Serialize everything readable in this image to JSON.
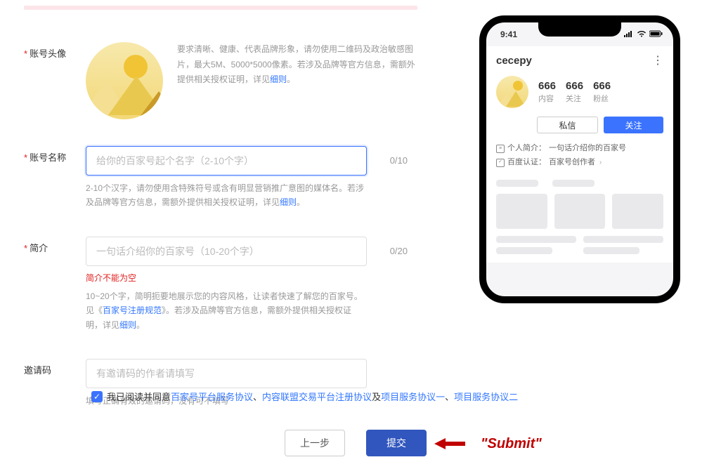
{
  "form": {
    "avatar": {
      "label": "账号头像",
      "desc_p1": "要求清晰、健康、代表品牌形象，请勿使用二维码及政治敏感图片，最大5M、5000*5000像素。若涉及品牌等官方信息，需额外提供相关授权证明，详见",
      "desc_link": "细则",
      "desc_end": "。"
    },
    "name": {
      "label": "账号名称",
      "placeholder": "给你的百家号起个名字（2-10个字）",
      "counter": "0/10",
      "hint_p1": "2-10个汉字，请勿使用含特殊符号或含有明显营销推广意图的媒体名。若涉及品牌等官方信息，需额外提供相关授权证明，详见",
      "hint_link": "细则",
      "hint_end": "。"
    },
    "intro": {
      "label": "简介",
      "placeholder": "一句话介绍你的百家号（10-20个字）",
      "counter": "0/20",
      "error": "简介不能为空",
      "hint_p1": "10~20个字，简明扼要地展示您的内容风格，让读者快速了解您的百家号。见《",
      "hint_link1": "百家号注册规范",
      "hint_p2": "》。若涉及品牌等官方信息，需额外提供相关授权证明，详见",
      "hint_link2": "细则",
      "hint_end": "。"
    },
    "invite": {
      "label": "邀请码",
      "placeholder": "有邀请码的作者请填写",
      "hint": "填写正确有效的邀请码，没有可不填写"
    }
  },
  "agreement": {
    "prefix": "我已阅读并同意",
    "link1": "百家号平台服务协议",
    "sep1": "、",
    "link2": "内容联盟交易平台注册协议",
    "sep2": "及",
    "link3": "项目服务协议一",
    "sep3": "、",
    "link4": "项目服务协议二"
  },
  "buttons": {
    "prev": "上一步",
    "submit": "提交"
  },
  "annotation": {
    "text": "\"Submit\""
  },
  "phone": {
    "time": "9:41",
    "username": "cecepy",
    "stats": {
      "posts_num": "666",
      "posts_lbl": "内容",
      "following_num": "666",
      "following_lbl": "关注",
      "followers_num": "666",
      "followers_lbl": "粉丝"
    },
    "btn_msg": "私信",
    "btn_follow": "关注",
    "bio_label": "个人简介：",
    "bio_text": "一句话介绍你的百家号",
    "cert_label": "百度认证：",
    "cert_text": "百家号创作者"
  }
}
